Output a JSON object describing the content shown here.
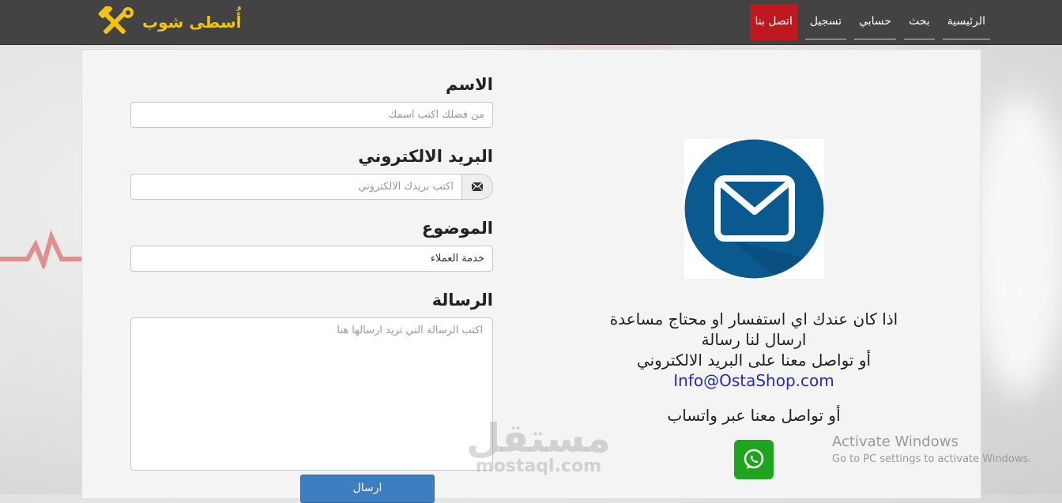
{
  "brand": {
    "name": "أُسطى شوب",
    "logo_icon": "hammer-wrench-icon",
    "color": "#f1c40f"
  },
  "nav": {
    "items": [
      {
        "label": "الرئيسية",
        "active": false
      },
      {
        "label": "بحث",
        "active": false
      },
      {
        "label": "حسابي",
        "active": false
      },
      {
        "label": "تسجيل",
        "active": false
      },
      {
        "label": "اتصل بنا",
        "active": true
      }
    ],
    "active_color": "#c0181f"
  },
  "form": {
    "name_label": "الاسم",
    "name_placeholder": "من فضلك اكتب اسمك",
    "email_label": "البريد الالكتروني",
    "email_placeholder": "اكتب بريدك الالكتروني",
    "email_icon": "envelope-icon",
    "subject_label": "الموضوع",
    "subject_value": "خدمة العملاء",
    "message_label": "الرسالة",
    "message_placeholder": "اكتب الرسالة التي تريد ارسالها هنا",
    "submit_label": "ارسال",
    "submit_color": "#3d7ec1"
  },
  "info": {
    "image_icon": "mail-envelope-icon",
    "line1": "اذا كان عندك اي استفسار او محتاج مساعدة",
    "line2": "ارسال لنا رسالة",
    "line3": "أو تواصل معنا على البريد الالكتروني",
    "email": "Info@OstaShop.com",
    "whatsapp_text": "أو تواصل معنا عبر واتساب",
    "whatsapp_icon": "whatsapp-icon",
    "whatsapp_color": "#1ea41e"
  },
  "overlay": {
    "watermark_ar": "مستقل",
    "watermark_en": "mostaql.com",
    "activate_title": "Activate Windows",
    "activate_sub": "Go to PC settings to activate Windows."
  }
}
